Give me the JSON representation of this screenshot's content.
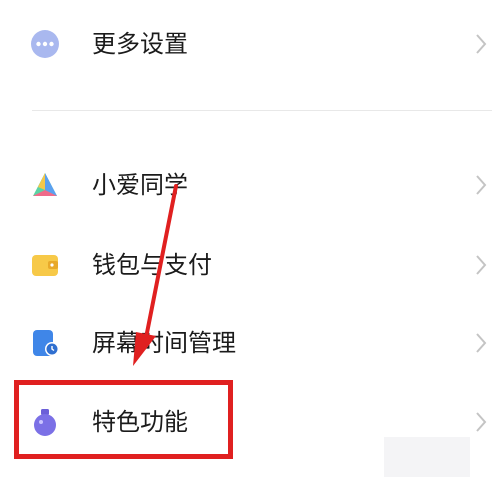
{
  "menu": {
    "items": [
      {
        "label": "更多设置",
        "icon": "more-dots-icon"
      },
      {
        "label": "小爱同学",
        "icon": "xiaoai-assistant-icon"
      },
      {
        "label": "钱包与支付",
        "icon": "wallet-icon"
      },
      {
        "label": "屏幕时间管理",
        "icon": "screen-time-icon"
      },
      {
        "label": "特色功能",
        "icon": "feature-flask-icon"
      }
    ],
    "chevron_icon": "chevron-right-icon"
  },
  "annotation": {
    "highlight_color": "#e02020",
    "highlighted_item": "特色功能"
  }
}
